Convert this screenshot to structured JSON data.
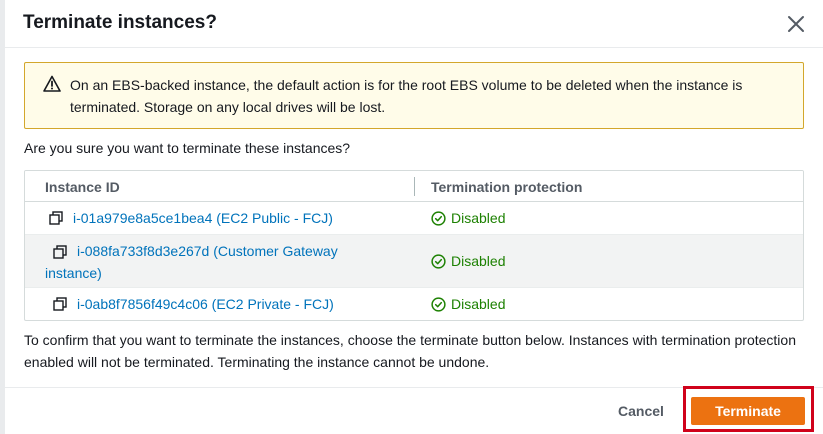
{
  "modal": {
    "title": "Terminate instances?",
    "warning": "On an EBS-backed instance, the default action is for the root EBS volume to be deleted when the instance is terminated. Storage on any local drives will be lost.",
    "question": "Are you sure you want to terminate these instances?",
    "confirm_text": "To confirm that you want to terminate the instances, choose the terminate button below. Instances with termination protection enabled will not be terminated. Terminating the instance cannot be undone."
  },
  "table": {
    "headers": [
      "Instance ID",
      "Termination protection"
    ],
    "rows": [
      {
        "instance": "i-01a979e8a5ce1bea4 (EC2 Public - FCJ)",
        "protection": "Disabled"
      },
      {
        "instance_line1": "i-088fa733f8d3e267d (Customer Gateway",
        "instance_line2": "instance)",
        "protection": "Disabled"
      },
      {
        "instance": "i-0ab8f7856f49c4c06 (EC2 Private - FCJ)",
        "protection": "Disabled"
      }
    ]
  },
  "footer": {
    "cancel_label": "Cancel",
    "terminate_label": "Terminate"
  },
  "colors": {
    "accent_orange": "#ec7211",
    "link_blue": "#0073bb",
    "success_green": "#1d8102",
    "warning_bg": "#fffce9",
    "highlight_red": "#d0021b"
  },
  "icons": {
    "close": "close-icon",
    "warning": "warning-icon",
    "copy": "copy-icon",
    "status": "check-circle-icon"
  }
}
